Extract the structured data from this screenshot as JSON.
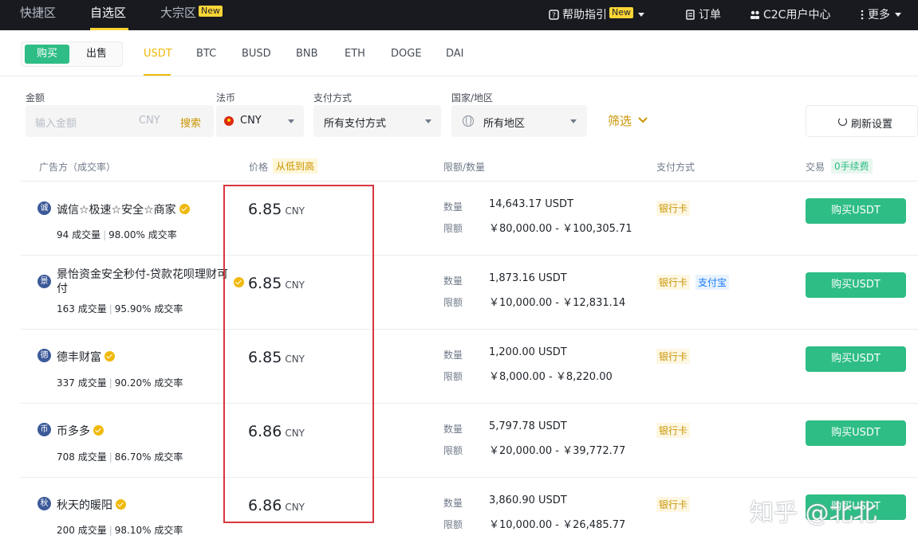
{
  "topnav": {
    "tabs": [
      "快捷区",
      "自选区",
      "大宗区"
    ],
    "new_badge": "New",
    "help": "帮助指引",
    "help_badge": "New",
    "orders": "订单",
    "c2c": "C2C用户中心",
    "more": "更多"
  },
  "toggle": {
    "buy": "购买",
    "sell": "出售"
  },
  "coins": [
    "USDT",
    "BTC",
    "BUSD",
    "BNB",
    "ETH",
    "DOGE",
    "DAI"
  ],
  "filters": {
    "amount_label": "金额",
    "amount_placeholder": "输入金额",
    "amount_unit": "CNY",
    "search": "搜索",
    "fiat_label": "法币",
    "fiat_value": "CNY",
    "payment_label": "支付方式",
    "payment_value": "所有支付方式",
    "region_label": "国家/地区",
    "region_value": "所有地区",
    "screen": "筛选",
    "refresh": "刷新设置"
  },
  "table_head": {
    "advertiser": "广告方（成交率）",
    "price": "价格",
    "sort": "从低到高",
    "limit": "限额/数量",
    "payment": "支付方式",
    "trade": "交易",
    "fee": "0手续费"
  },
  "labels": {
    "qty": "数量",
    "limit": "限额",
    "currency": "CNY",
    "buy_btn": "购买USDT"
  },
  "rows": [
    {
      "avatar": "诚",
      "name": "诚信☆极速☆安全☆商家",
      "orders": "94 成交量",
      "rate": "98.00% 成交率",
      "price": "6.85",
      "qty": "14,643.17 USDT",
      "limit": "￥80,000.00 - ￥100,305.71",
      "pay": [
        "银行卡"
      ]
    },
    {
      "avatar": "景",
      "name": "景怡资金安全秒付-贷款花呗理财可付",
      "orders": "163 成交量",
      "rate": "95.90% 成交率",
      "price": "6.85",
      "qty": "1,873.16 USDT",
      "limit": "￥10,000.00 - ￥12,831.14",
      "pay": [
        "银行卡",
        "支付宝"
      ]
    },
    {
      "avatar": "德",
      "name": "德丰财富",
      "orders": "337 成交量",
      "rate": "90.20% 成交率",
      "price": "6.85",
      "qty": "1,200.00 USDT",
      "limit": "￥8,000.00 - ￥8,220.00",
      "pay": [
        "银行卡"
      ]
    },
    {
      "avatar": "币",
      "name": "币多多",
      "orders": "708 成交量",
      "rate": "86.70% 成交率",
      "price": "6.86",
      "qty": "5,797.78 USDT",
      "limit": "￥20,000.00 - ￥39,772.77",
      "pay": [
        "银行卡"
      ]
    },
    {
      "avatar": "秋",
      "name": "秋天的暖阳",
      "orders": "200 成交量",
      "rate": "98.10% 成交率",
      "price": "6.86",
      "qty": "3,860.90 USDT",
      "limit": "￥10,000.00 - ￥26,485.77",
      "pay": [
        "银行卡"
      ]
    }
  ],
  "watermark": "知乎 @北北",
  "colors": {
    "accent_green": "#2ebd85",
    "brand_yellow": "#f0b90b",
    "highlight_red": "#d9363e",
    "nav_bg": "#181a20"
  }
}
